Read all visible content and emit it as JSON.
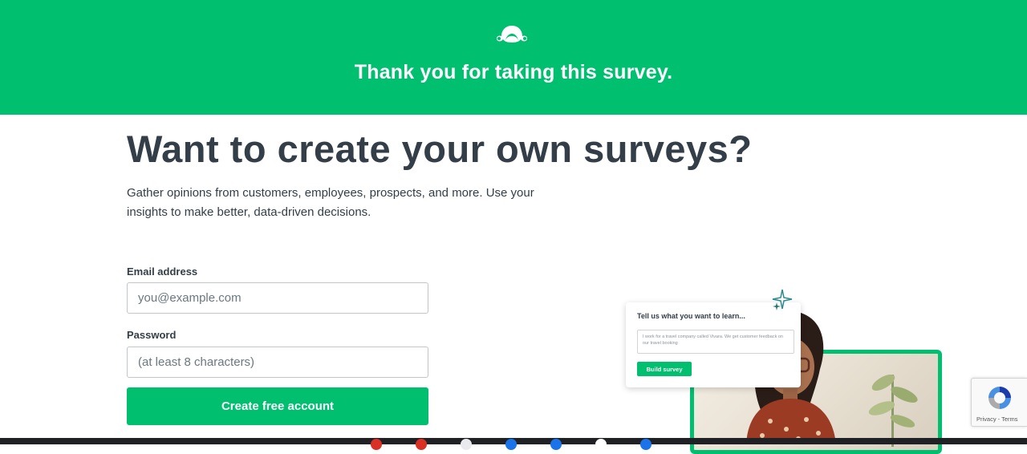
{
  "banner": {
    "logo_icon": "surveymonkey-logo-icon",
    "title": "Thank you for taking this survey.",
    "color": "#00bf6f"
  },
  "main": {
    "headline": "Want to create your own surveys?",
    "subtext": "Gather opinions from customers, employees, prospects, and more. Use your insights to make better, data-driven decisions."
  },
  "form": {
    "email_label": "Email address",
    "email_placeholder": "you@example.com",
    "email_value": "",
    "password_label": "Password",
    "password_placeholder": "(at least 8 characters)",
    "password_value": "",
    "submit_label": "Create free account"
  },
  "illustration": {
    "prompt_title": "Tell us what you want to learn...",
    "prompt_text": "I work for a travel company called Vivara. We get customer feedback on our travel booking",
    "build_button": "Build survey",
    "sparkle_icon": "sparkle-icon"
  },
  "recaptcha": {
    "icon": "recaptcha-icon",
    "links": "Privacy - Terms"
  },
  "colors": {
    "brand_green": "#00bf6f",
    "text_dark": "#333e48"
  }
}
